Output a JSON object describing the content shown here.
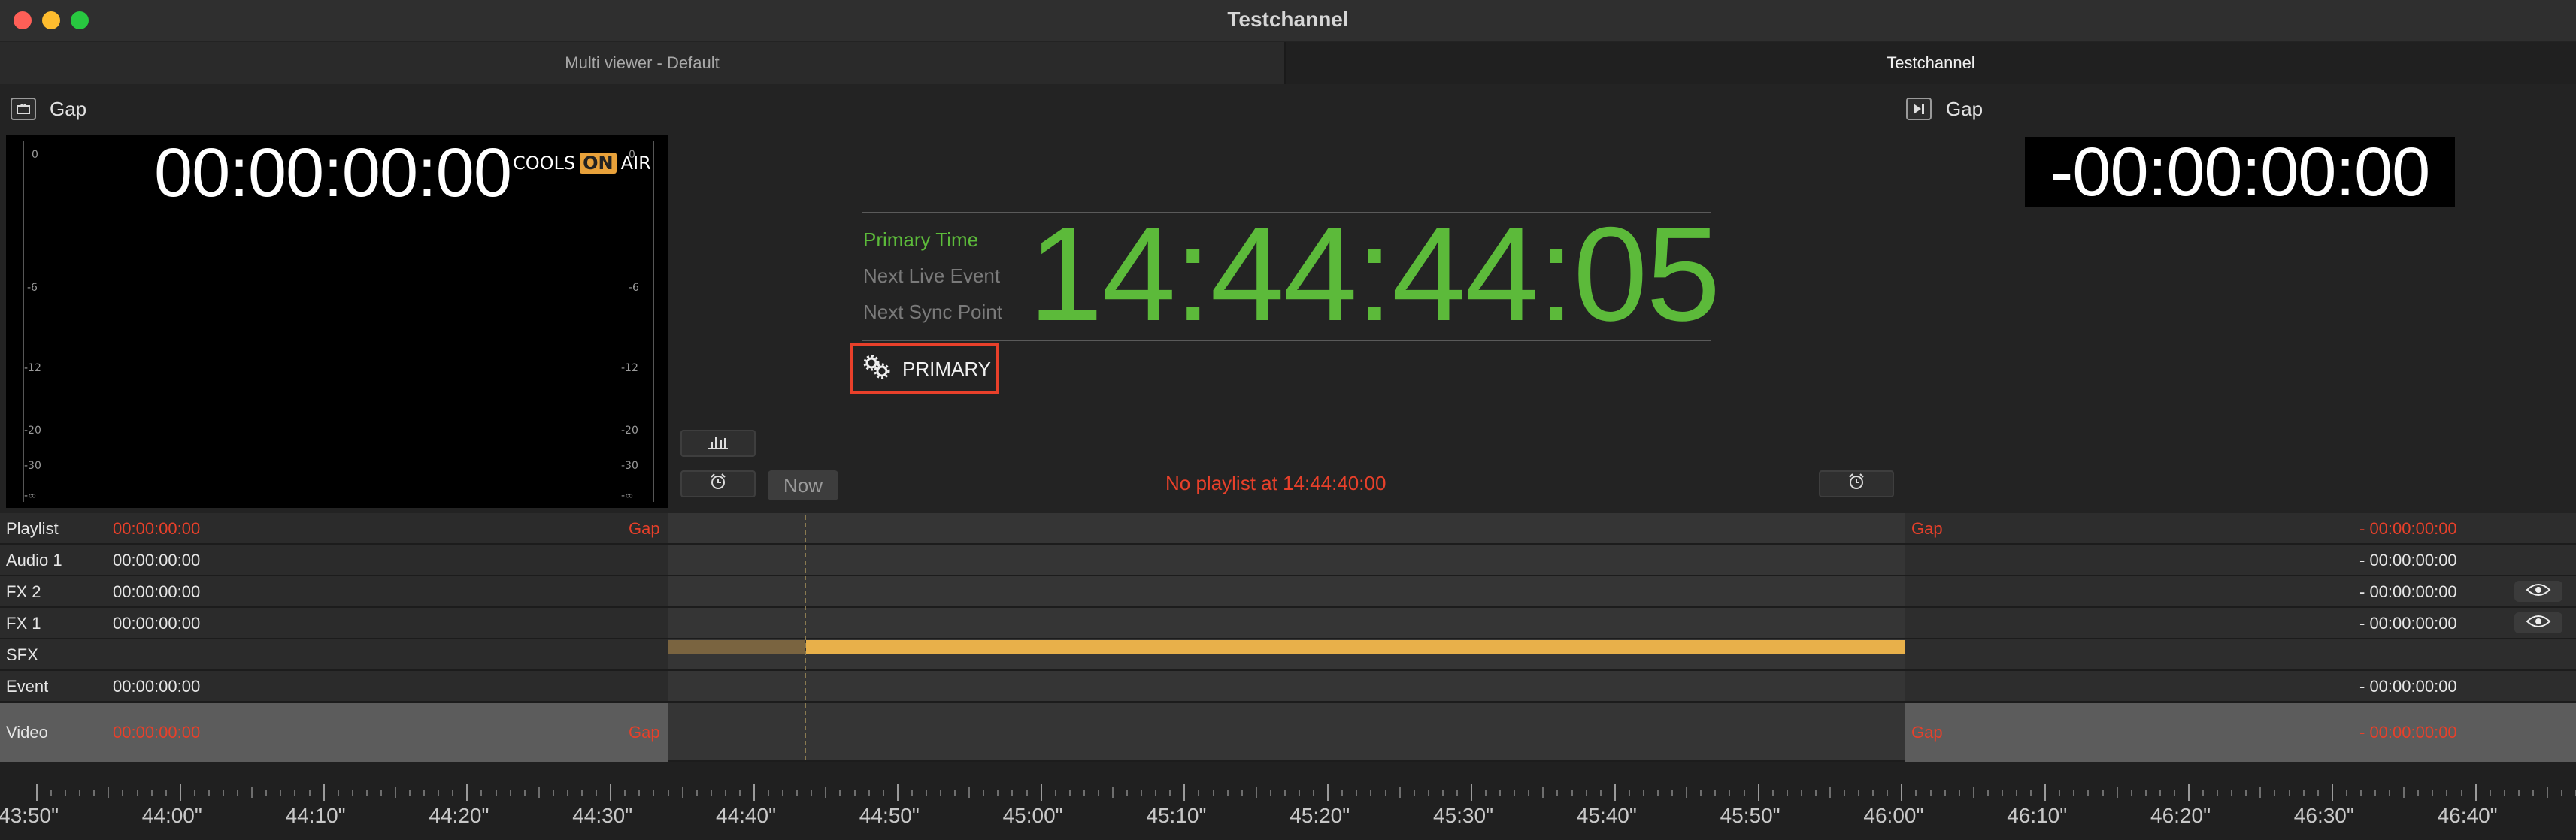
{
  "window": {
    "title": "Testchannel"
  },
  "tabs": [
    {
      "label": "Multi viewer - Default"
    },
    {
      "label": "Testchannel"
    }
  ],
  "current": {
    "label": "Gap",
    "timecode": "00:00:00:00",
    "logo_left": "COOLS",
    "logo_on": "ON",
    "logo_right": "AIR"
  },
  "meter_ticks": [
    "0",
    "-6",
    "-12",
    "-20",
    "-30",
    "-∞"
  ],
  "clock": {
    "labels": [
      "Primary Time",
      "Next Live Event",
      "Next Sync Point"
    ],
    "active_label_color": "#5cba3a",
    "time": "14:44:44:05",
    "mode_button": "PRIMARY"
  },
  "controls": {
    "now_label": "Now"
  },
  "status": {
    "no_playlist": "No playlist at 14:44:40:00"
  },
  "next": {
    "label": "Gap",
    "timecode": "-00:00:00:00"
  },
  "tracks": [
    {
      "name": "Playlist",
      "tc": "00:00:00:00",
      "gap": "Gap",
      "right_gap": "Gap",
      "right_tc": "- 00:00:00:00",
      "red": true
    },
    {
      "name": "Audio 1",
      "tc": "00:00:00:00",
      "gap": "",
      "right_gap": "",
      "right_tc": "- 00:00:00:00",
      "red": false
    },
    {
      "name": "FX 2",
      "tc": "00:00:00:00",
      "gap": "",
      "right_gap": "",
      "right_tc": "- 00:00:00:00",
      "red": false
    },
    {
      "name": "FX 1",
      "tc": "00:00:00:00",
      "gap": "",
      "right_gap": "",
      "right_tc": "- 00:00:00:00",
      "red": false
    },
    {
      "name": "SFX",
      "tc": "",
      "gap": "",
      "right_gap": "",
      "right_tc": "",
      "red": false
    },
    {
      "name": "Event",
      "tc": "00:00:00:00",
      "gap": "",
      "right_gap": "",
      "right_tc": "- 00:00:00:00",
      "red": false
    },
    {
      "name": "Video",
      "tc": "00:00:00:00",
      "gap": "Gap",
      "right_gap": "Gap",
      "right_tc": "- 00:00:00:00",
      "red": true
    }
  ],
  "ruler": [
    "43:50\"",
    "44:00\"",
    "44:10\"",
    "44:20\"",
    "44:30\"",
    "44:40\"",
    "44:50\"",
    "45:00\"",
    "45:10\"",
    "45:20\"",
    "45:30\"",
    "45:40\"",
    "45:50\"",
    "46:00\"",
    "46:10\"",
    "46:20\"",
    "46:30\"",
    "46:40\""
  ],
  "colors": {
    "accent_green": "#5cba3a",
    "alert_red": "#e8402a",
    "sfx_bar": "#e8b04a"
  },
  "icons": {
    "current": "monitor-icon",
    "next": "play-next-icon",
    "primary": "gears-icon",
    "alarm": "alarm-clock-icon",
    "eye": "eye-icon",
    "meter": "bar-meter-icon"
  }
}
